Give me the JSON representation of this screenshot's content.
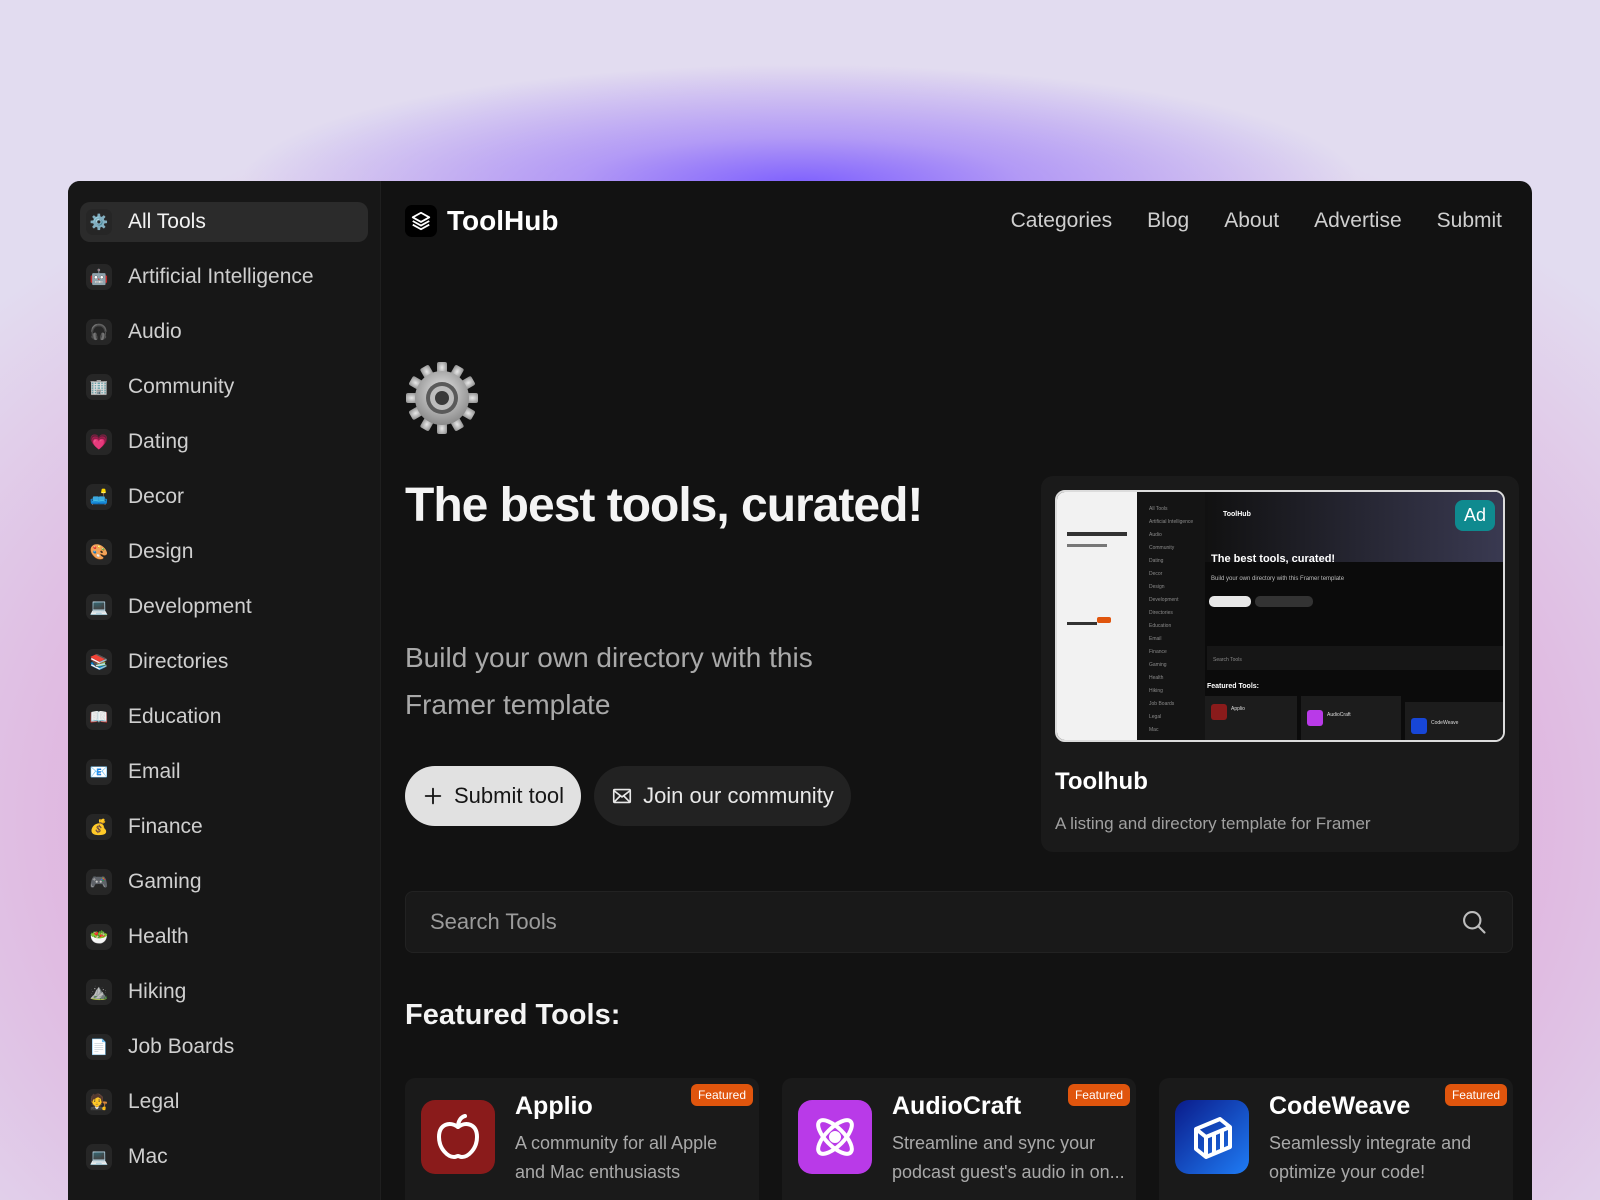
{
  "brand": {
    "name": "ToolHub"
  },
  "nav": [
    "Categories",
    "Blog",
    "About",
    "Advertise",
    "Submit"
  ],
  "sidebar": {
    "items": [
      {
        "label": "All Tools",
        "icon": "⚙️",
        "active": true
      },
      {
        "label": "Artificial Intelligence",
        "icon": "🤖"
      },
      {
        "label": "Audio",
        "icon": "🎧"
      },
      {
        "label": "Community",
        "icon": "🏢"
      },
      {
        "label": "Dating",
        "icon": "💗"
      },
      {
        "label": "Decor",
        "icon": "🛋️"
      },
      {
        "label": "Design",
        "icon": "🎨"
      },
      {
        "label": "Development",
        "icon": "💻"
      },
      {
        "label": "Directories",
        "icon": "📚"
      },
      {
        "label": "Education",
        "icon": "📖"
      },
      {
        "label": "Email",
        "icon": "📧"
      },
      {
        "label": "Finance",
        "icon": "💰"
      },
      {
        "label": "Gaming",
        "icon": "🎮"
      },
      {
        "label": "Health",
        "icon": "🥗"
      },
      {
        "label": "Hiking",
        "icon": "⛰️"
      },
      {
        "label": "Job Boards",
        "icon": "📄"
      },
      {
        "label": "Legal",
        "icon": "🧑‍⚖️"
      },
      {
        "label": "Mac",
        "icon": "💻"
      }
    ]
  },
  "hero": {
    "title": "The best tools, curated!",
    "subtitle": "Build your own directory with this Framer template",
    "primary_button": "Submit tool",
    "secondary_button": "Join our community"
  },
  "ad": {
    "badge": "Ad",
    "title": "Toolhub",
    "description": "A listing and directory template for Framer",
    "preview": {
      "brand": "ToolHub",
      "title": "The best tools, curated!",
      "subtitle": "Build your own directory with this Framer template",
      "search": "Search Tools",
      "featured": "Featured Tools:",
      "sidebar": [
        "All Tools",
        "Artificial Intelligence",
        "Audio",
        "Community",
        "Dating",
        "Decor",
        "Design",
        "Development",
        "Directories",
        "Education",
        "Email",
        "Finance",
        "Gaming",
        "Health",
        "Hiking",
        "Job Boards",
        "Legal",
        "Mac"
      ],
      "cards": [
        "Applio",
        "AudioCraft",
        "CodeWeave"
      ]
    }
  },
  "search": {
    "placeholder": "Search Tools"
  },
  "featured": {
    "heading": "Featured Tools:",
    "badge": "Featured",
    "tools": [
      {
        "name": "Applio",
        "description": "A community for all Apple and Mac enthusiasts",
        "icon": "apple-icon",
        "color": "#8a1b1b"
      },
      {
        "name": "AudioCraft",
        "description": "Streamline and sync your podcast guest's audio in on...",
        "icon": "atom-icon",
        "color": "#b93ae8"
      },
      {
        "name": "CodeWeave",
        "description": "Seamlessly integrate and optimize your code!",
        "icon": "cube-icon",
        "color": "#1746d6"
      }
    ]
  },
  "colors": {
    "background": "#121212",
    "sidebar": "#171717",
    "accent_badge": "#e0550d",
    "ad_badge": "#0f8a8f"
  }
}
